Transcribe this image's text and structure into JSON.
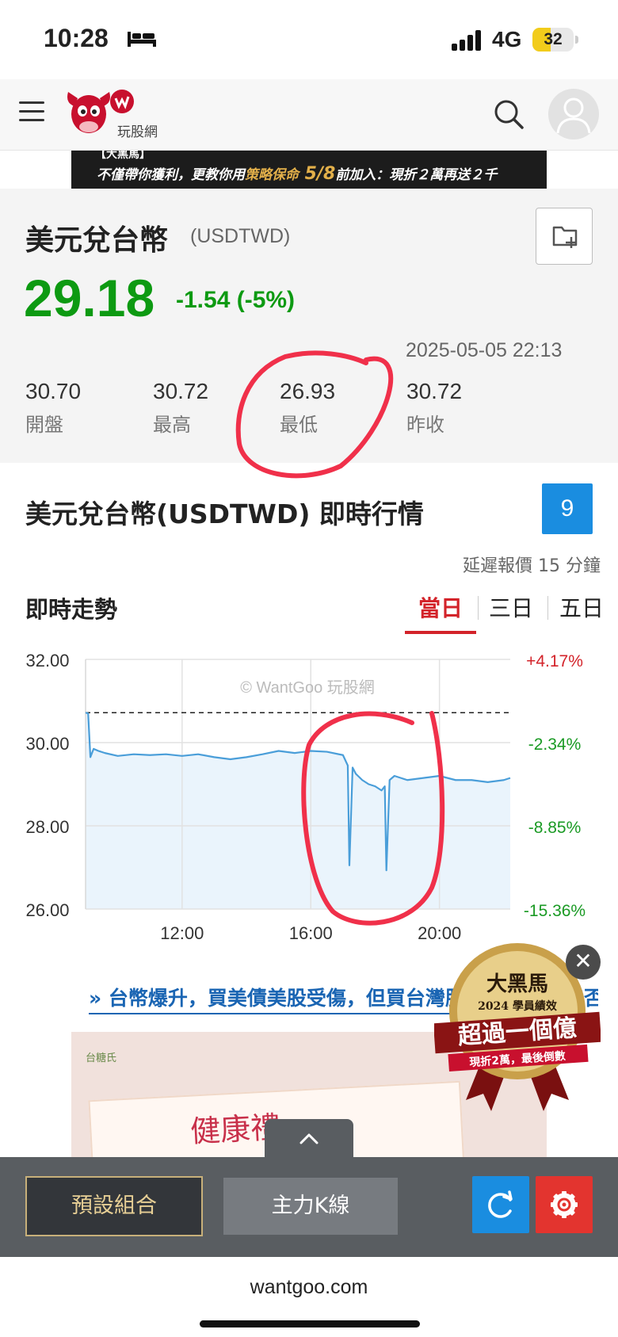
{
  "status_bar": {
    "time": "10:28",
    "network": "4G",
    "battery": "32"
  },
  "header": {
    "logo_text": "玩股網"
  },
  "banner": {
    "line1": "【大黑馬】",
    "line2_prefix": "不僅帶你獲利，更教你用",
    "line2_highlight": "策略保命",
    "line2_date": " 5/8",
    "line2_suffix": "前加入：現折２萬再送２千"
  },
  "quote": {
    "name": "美元兌台幣",
    "code": "(USDTWD)",
    "price": "29.18",
    "change": "-1.54 (-5%)",
    "datetime": "2025-05-05 22:13",
    "stats": [
      {
        "value": "30.70",
        "label": "開盤"
      },
      {
        "value": "30.72",
        "label": "最高"
      },
      {
        "value": "26.93",
        "label": "最低"
      },
      {
        "value": "30.72",
        "label": "昨收"
      }
    ]
  },
  "realtime": {
    "title": "美元兌台幣(USDTWD) 即時行情",
    "badge": "9",
    "delay_note": "延遲報價 15 分鐘",
    "trend_title": "即時走勢",
    "tabs": [
      "當日",
      "三日",
      "五日"
    ],
    "active_tab": "當日"
  },
  "chart_data": {
    "type": "area",
    "watermark": "© WantGoo 玩股網",
    "y_ticks": [
      "32.00",
      "30.00",
      "28.00",
      "26.00"
    ],
    "y_right_ticks": [
      "+4.17%",
      "-2.34%",
      "-8.85%",
      "-15.36%"
    ],
    "x_ticks": [
      "12:00",
      "16:00",
      "20:00"
    ],
    "ylim": [
      26.0,
      32.0
    ],
    "reference_line": 30.72,
    "x_unit": "hour",
    "x": [
      9.0,
      9.08,
      9.15,
      9.25,
      9.4,
      9.6,
      10.0,
      10.5,
      11.0,
      11.5,
      12.0,
      12.5,
      13.0,
      13.5,
      14.0,
      14.5,
      15.0,
      15.5,
      16.0,
      16.5,
      17.0,
      17.15,
      17.2,
      17.3,
      17.4,
      17.6,
      17.8,
      18.0,
      18.2,
      18.3,
      18.35,
      18.45,
      18.6,
      18.8,
      19.0,
      19.5,
      20.0,
      20.5,
      21.0,
      21.5,
      22.0,
      22.2
    ],
    "y": [
      30.72,
      30.7,
      29.65,
      29.85,
      29.8,
      29.75,
      29.68,
      29.72,
      29.7,
      29.72,
      29.68,
      29.72,
      29.65,
      29.6,
      29.65,
      29.72,
      29.8,
      29.75,
      29.8,
      29.78,
      29.7,
      29.45,
      27.05,
      29.4,
      29.25,
      29.1,
      29.0,
      28.95,
      28.85,
      28.95,
      26.93,
      29.1,
      29.2,
      29.15,
      29.1,
      29.15,
      29.2,
      29.1,
      29.1,
      29.05,
      29.1,
      29.15
    ],
    "colors": {
      "line": "#4a9ed9",
      "fill": "#eaf4fc",
      "axis_left": "#333333",
      "axis_right_up": "#d3232a",
      "axis_right_down": "#1a9a24"
    }
  },
  "news": {
    "link_text": "» 台幣爆升，買美債美股受傷，但買台灣股票的投資人能否受惠？外資看好"
  },
  "ad": {
    "brand": "台糖氏",
    "text": "健康禮"
  },
  "promo": {
    "line1": "大黑馬",
    "line2": "2024 學員績效",
    "line3": "超過一個億",
    "line4": "現折2萬，最後倒數"
  },
  "toolbar": {
    "preset_label": "預設組合",
    "kline_label": "主力K線"
  },
  "footer": {
    "domain": "wantgoo.com"
  },
  "icons": [
    "bed-icon",
    "signal-icon",
    "battery-icon",
    "menu-icon",
    "logo-icon",
    "search-icon",
    "avatar-icon",
    "folder-add-icon",
    "close-icon",
    "chevron-up-icon",
    "refresh-icon",
    "gear-icon"
  ]
}
